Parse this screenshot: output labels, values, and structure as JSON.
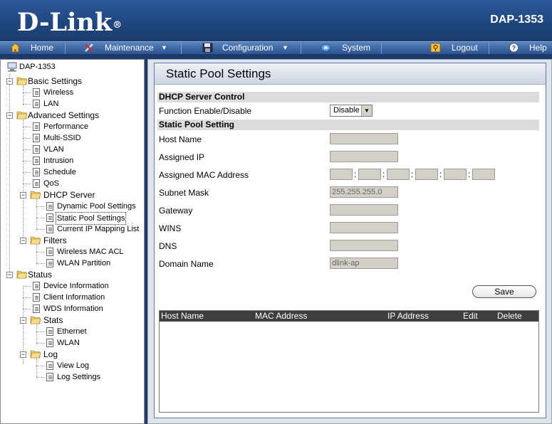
{
  "header": {
    "logo": "D-Link",
    "model": "DAP-1353"
  },
  "menu": [
    {
      "label": "Home",
      "icon": "home-icon"
    },
    {
      "label": "Maintenance",
      "icon": "tools-icon",
      "dropdown": true
    },
    {
      "label": "Configuration",
      "icon": "disk-icon",
      "dropdown": true
    },
    {
      "label": "System",
      "icon": "system-icon"
    },
    {
      "label": "Logout",
      "icon": "logout-icon"
    },
    {
      "label": "Help",
      "icon": "help-icon"
    }
  ],
  "tree": {
    "root": "DAP-1353",
    "basic": "Basic Settings",
    "wireless": "Wireless",
    "lan": "LAN",
    "advanced": "Advanced Settings",
    "performance": "Performance",
    "multissid": "Multi-SSID",
    "vlan": "VLAN",
    "intrusion": "Intrusion",
    "schedule": "Schedule",
    "qos": "QoS",
    "dhcp": "DHCP Server",
    "dynamic": "Dynamic Pool Settings",
    "static": "Static Pool Settings",
    "mapping": "Current IP Mapping List",
    "filters": "Filters",
    "mac_acl": "Wireless MAC ACL",
    "wlan_partition": "WLAN Partition",
    "status": "Status",
    "device_info": "Device Information",
    "client_info": "Client Information",
    "wds_info": "WDS Information",
    "stats": "Stats",
    "ethernet": "Ethernet",
    "wlan": "WLAN",
    "log": "Log",
    "view_log": "View Log",
    "log_settings": "Log Settings"
  },
  "page": {
    "title": "Static Pool Settings",
    "section_control": "DHCP Server Control",
    "function_label": "Function Enable/Disable",
    "function_value": "Disable",
    "section_static": "Static Pool Setting",
    "host_name_label": "Host Name",
    "assigned_ip_label": "Assigned IP",
    "assigned_mac_label": "Assigned MAC Address",
    "subnet_label": "Subnet Mask",
    "subnet_value": "255.255.255.0",
    "gateway_label": "Gateway",
    "wins_label": "WINS",
    "dns_label": "DNS",
    "domain_label": "Domain Name",
    "domain_value": "dlink-ap",
    "mac_sep": ":",
    "save": "Save"
  },
  "table": {
    "headers": [
      "Host Name",
      "MAC Address",
      "IP Address",
      "Edit",
      "Delete"
    ]
  }
}
